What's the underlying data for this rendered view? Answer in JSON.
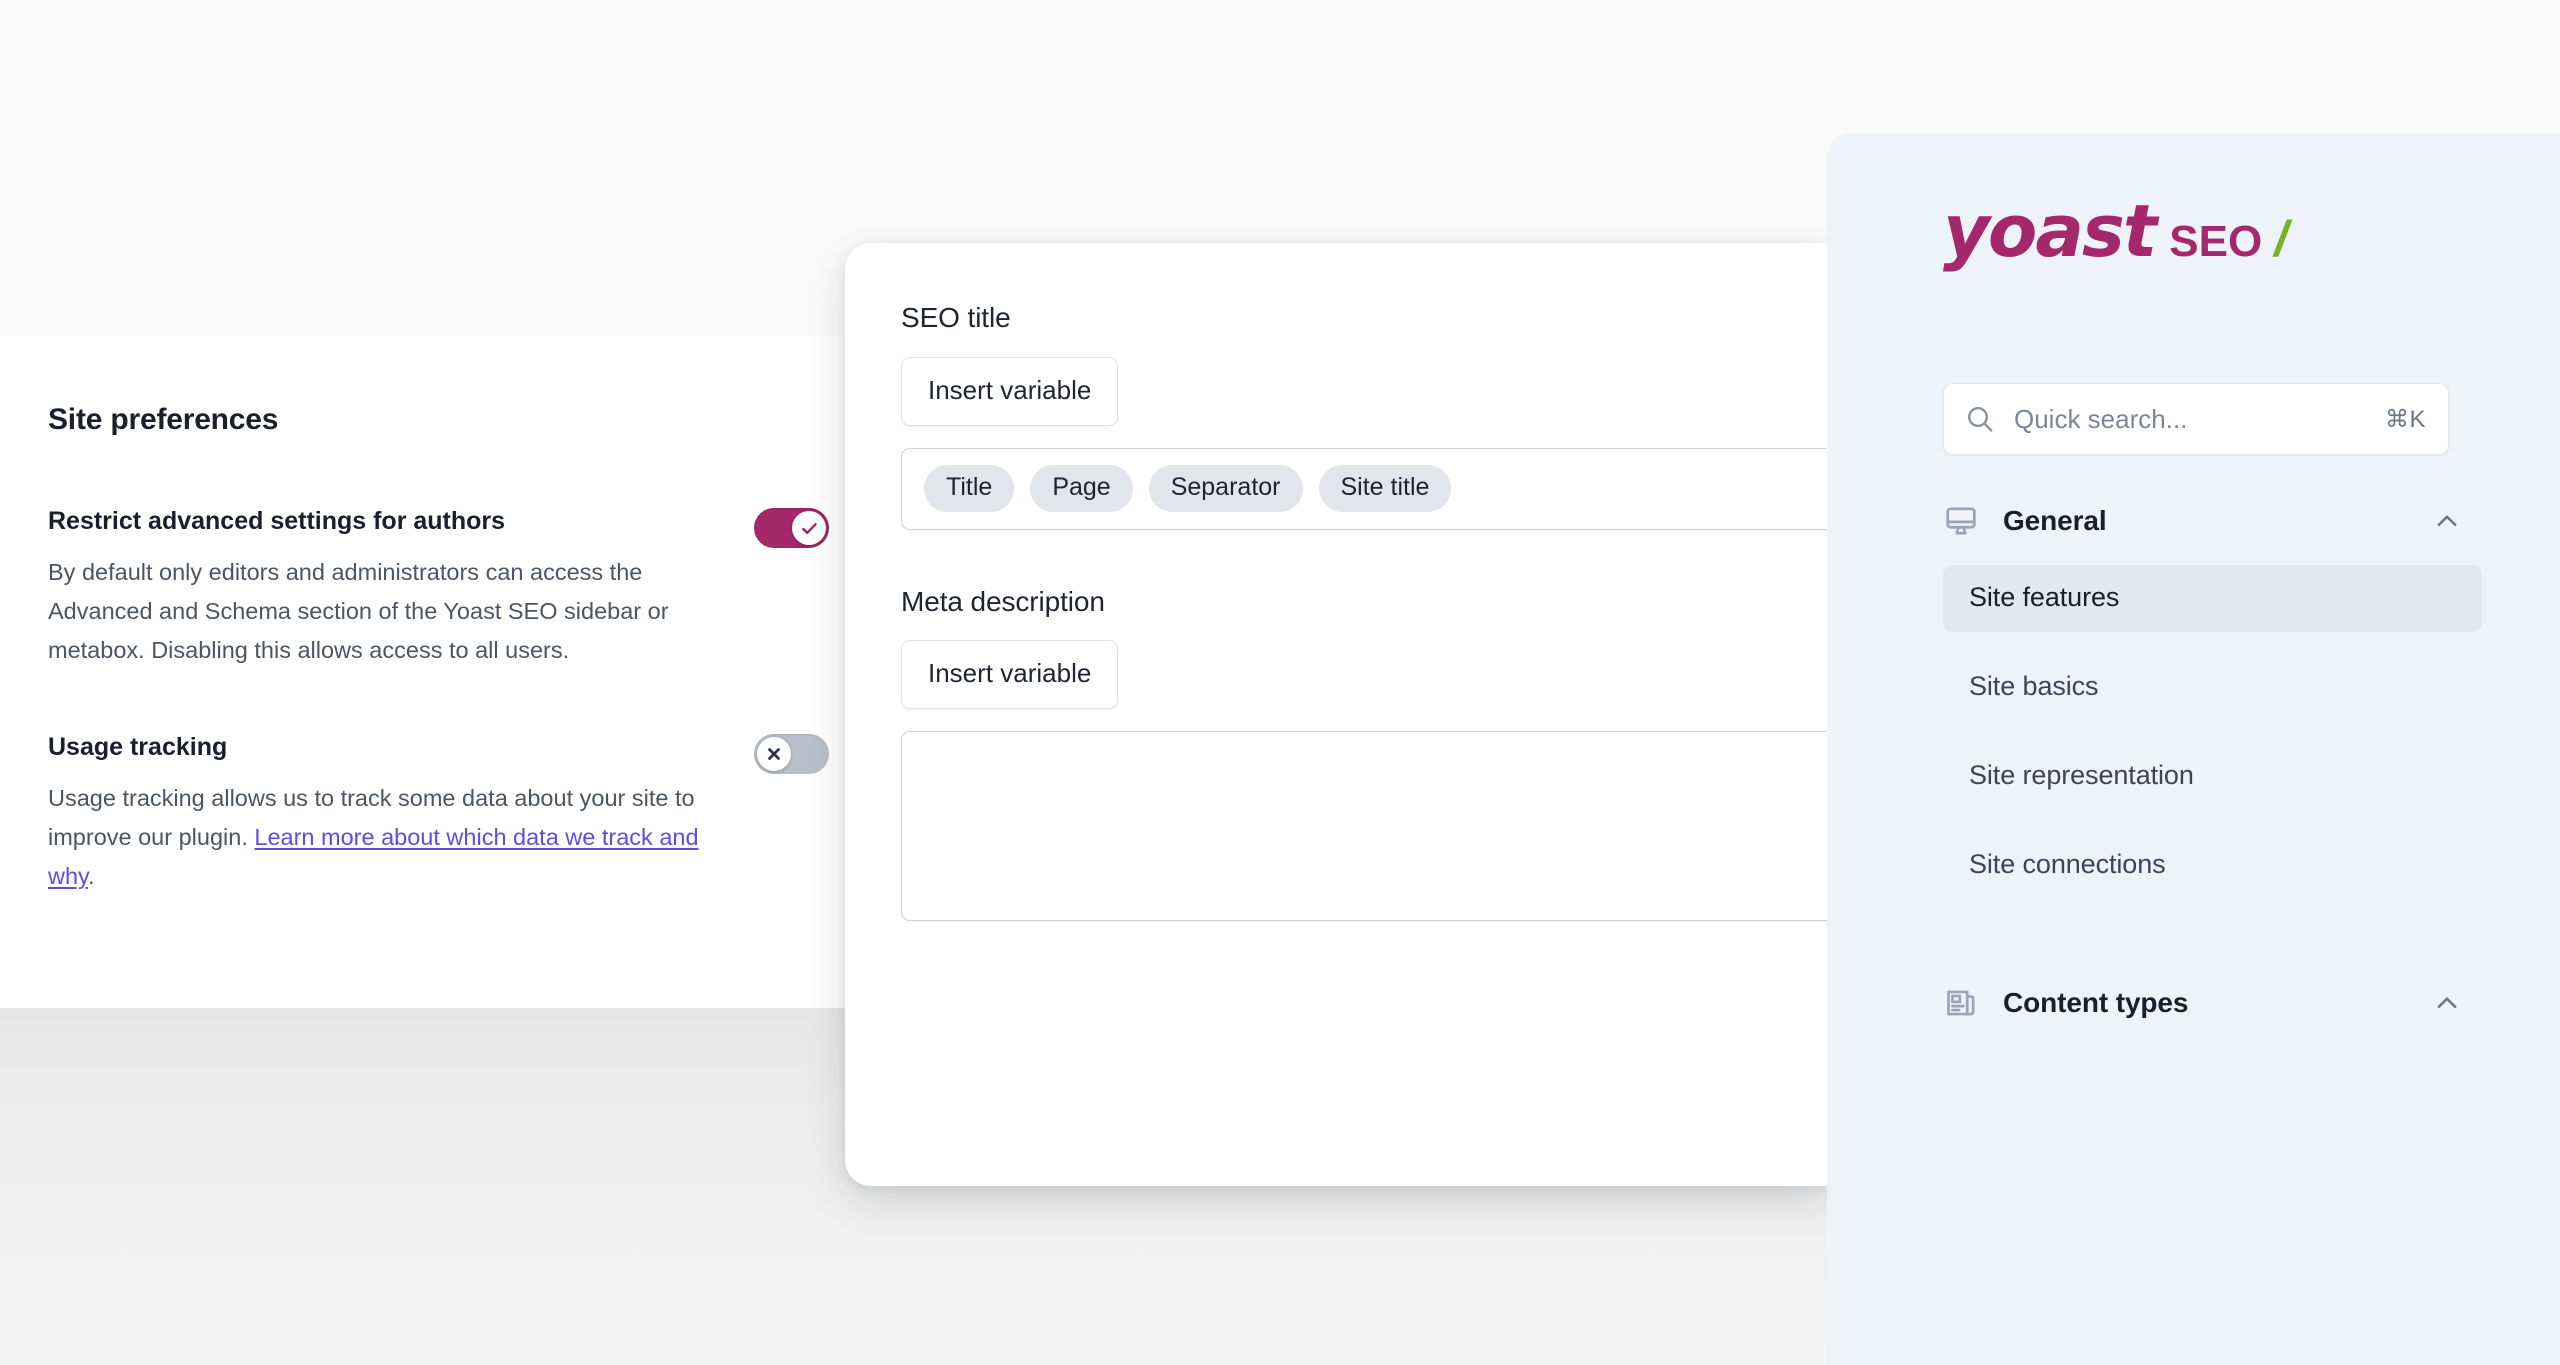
{
  "left_panel": {
    "title": "Site preferences",
    "preferences": [
      {
        "label": "Restrict advanced settings for authors",
        "description": "By default only editors and administrators can access the Advanced and Schema section of the Yoast SEO sidebar or metabox. Disabling this allows access to all users.",
        "toggle_state": "on",
        "toggle_glyph": "check-icon"
      },
      {
        "label": "Usage tracking",
        "description_before": "Usage tracking allows us to track some data about your site to improve our plugin. ",
        "link_text": "Learn more about which data we track and why",
        "description_after": ".",
        "toggle_state": "off",
        "toggle_glyph": "close-icon"
      }
    ]
  },
  "center_card": {
    "seo_title": {
      "label": "SEO title",
      "insert_variable_label": "Insert variable",
      "variables": [
        "Title",
        "Page",
        "Separator",
        "Site title"
      ]
    },
    "meta_description": {
      "label": "Meta description",
      "insert_variable_label": "Insert variable",
      "value": "",
      "placeholder": ""
    }
  },
  "sidebar": {
    "logo": {
      "brand": "yoast",
      "product": "SEO",
      "slash": "/"
    },
    "search": {
      "placeholder": "Quick search...",
      "value": "",
      "shortcut": "⌘K",
      "icon": "search-icon"
    },
    "groups": [
      {
        "label": "General",
        "icon": "monitor-icon",
        "expanded": true,
        "chevron": "chevron-up-icon",
        "items": [
          {
            "label": "Site features",
            "active": true
          },
          {
            "label": "Site basics",
            "active": false
          },
          {
            "label": "Site representation",
            "active": false
          },
          {
            "label": "Site connections",
            "active": false
          }
        ]
      },
      {
        "label": "Content types",
        "icon": "article-icon",
        "expanded": true,
        "chevron": "chevron-up-icon",
        "items": []
      }
    ]
  },
  "colors": {
    "brand_magenta": "#a4286a",
    "brand_green": "#77b227",
    "sidebar_bg": "#eef2f9",
    "active_item_bg": "#e2e7f0",
    "link": "#5b4ee8",
    "toggle_off": "#b8c0cc",
    "chip_bg": "#e2e5ec"
  }
}
